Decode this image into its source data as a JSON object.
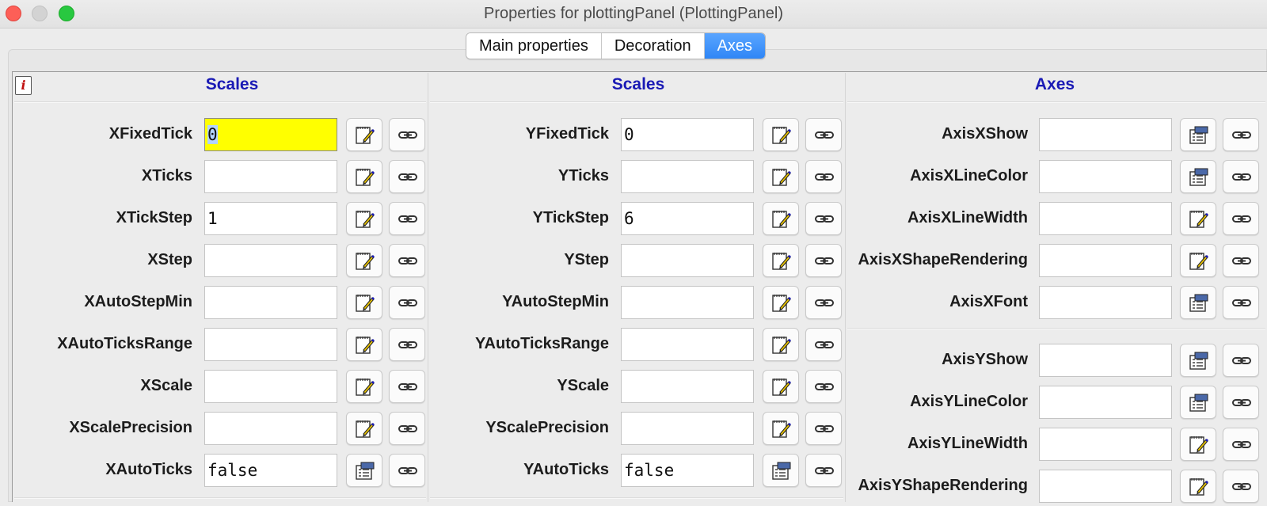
{
  "window": {
    "title": "Properties for plottingPanel (PlottingPanel)"
  },
  "tabs": [
    {
      "label": "Main properties",
      "active": false
    },
    {
      "label": "Decoration",
      "active": false
    },
    {
      "label": "Axes",
      "active": true
    }
  ],
  "columns": [
    {
      "title": "Scales",
      "rows": [
        {
          "label": "XFixedTick",
          "value": "0",
          "highlight": true,
          "edit_icon": "edit-icon"
        },
        {
          "label": "XTicks",
          "value": "",
          "edit_icon": "edit-icon"
        },
        {
          "label": "XTickStep",
          "value": "1",
          "edit_icon": "edit-icon"
        },
        {
          "label": "XStep",
          "value": "",
          "edit_icon": "edit-icon"
        },
        {
          "label": "XAutoStepMin",
          "value": "",
          "edit_icon": "edit-icon"
        },
        {
          "label": "XAutoTicksRange",
          "value": "",
          "edit_icon": "edit-icon"
        },
        {
          "label": "XScale",
          "value": "",
          "edit_icon": "edit-icon"
        },
        {
          "label": "XScalePrecision",
          "value": "",
          "edit_icon": "edit-icon"
        },
        {
          "label": "XAutoTicks",
          "value": "false",
          "edit_icon": "options-icon"
        }
      ]
    },
    {
      "title": "Scales",
      "rows": [
        {
          "label": "YFixedTick",
          "value": "0",
          "edit_icon": "edit-icon"
        },
        {
          "label": "YTicks",
          "value": "",
          "edit_icon": "edit-icon"
        },
        {
          "label": "YTickStep",
          "value": "6",
          "edit_icon": "edit-icon"
        },
        {
          "label": "YStep",
          "value": "",
          "edit_icon": "edit-icon"
        },
        {
          "label": "YAutoStepMin",
          "value": "",
          "edit_icon": "edit-icon"
        },
        {
          "label": "YAutoTicksRange",
          "value": "",
          "edit_icon": "edit-icon"
        },
        {
          "label": "YScale",
          "value": "",
          "edit_icon": "edit-icon"
        },
        {
          "label": "YScalePrecision",
          "value": "",
          "edit_icon": "edit-icon"
        },
        {
          "label": "YAutoTicks",
          "value": "false",
          "edit_icon": "options-icon"
        }
      ]
    },
    {
      "title": "Axes",
      "rows": [
        {
          "label": "AxisXShow",
          "value": "",
          "edit_icon": "options-icon"
        },
        {
          "label": "AxisXLineColor",
          "value": "",
          "edit_icon": "options-icon"
        },
        {
          "label": "AxisXLineWidth",
          "value": "",
          "edit_icon": "edit-icon"
        },
        {
          "label": "AxisXShapeRendering",
          "value": "",
          "edit_icon": "edit-icon"
        },
        {
          "label": "AxisXFont",
          "value": "",
          "edit_icon": "options-icon"
        },
        {
          "label": "AxisYShow",
          "value": "",
          "edit_icon": "options-icon"
        },
        {
          "label": "AxisYLineColor",
          "value": "",
          "edit_icon": "options-icon"
        },
        {
          "label": "AxisYLineWidth",
          "value": "",
          "edit_icon": "edit-icon"
        },
        {
          "label": "AxisYShapeRendering",
          "value": "",
          "edit_icon": "edit-icon"
        }
      ]
    }
  ],
  "colors": {
    "section_title": "#1a1ab5",
    "highlight_field": "#ffff00",
    "active_tab": "#2f86f6"
  }
}
